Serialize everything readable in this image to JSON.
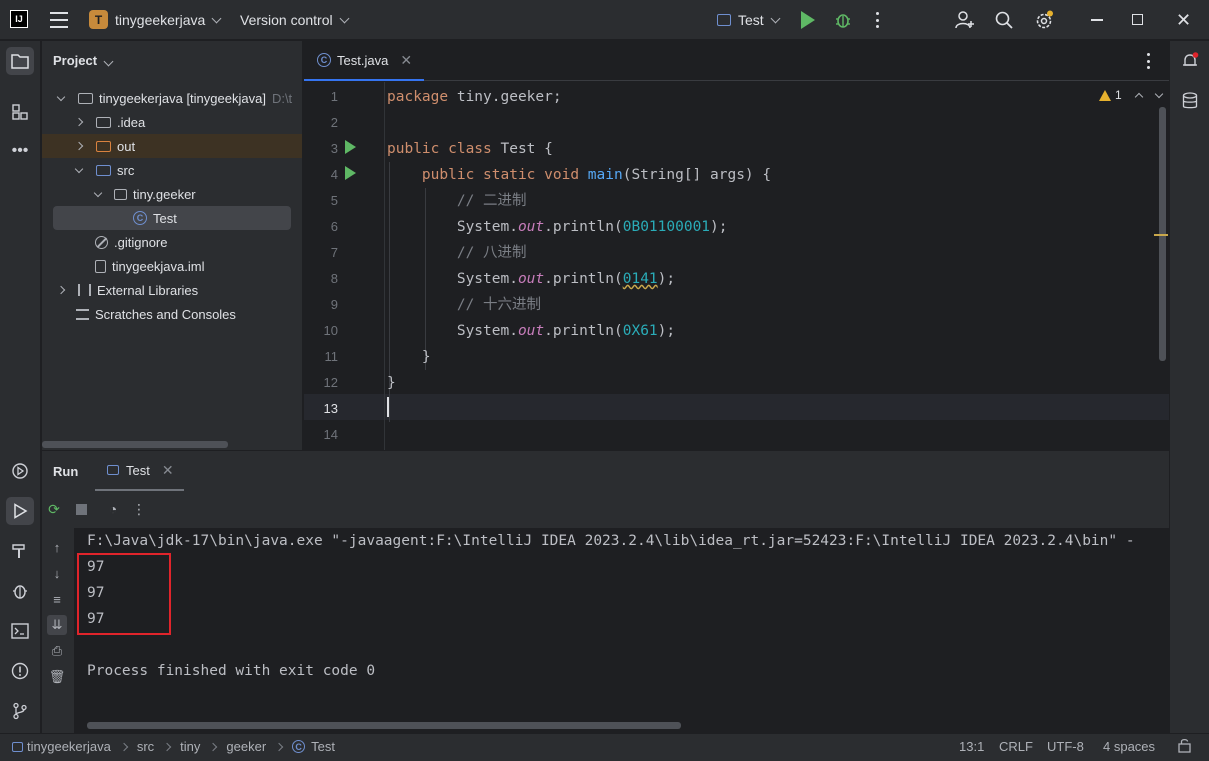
{
  "titlebar": {
    "logo": "IJ",
    "project_badge": "T",
    "project_name": "tinygeekerjava",
    "vcs_label": "Version control",
    "run_config": "Test",
    "icons": [
      "hamburger-icon",
      "run-icon",
      "debug-icon",
      "more-icon",
      "add-user-icon",
      "search-icon",
      "settings-icon",
      "minimize-icon",
      "maximize-icon",
      "close-icon"
    ],
    "settings_badge_color": "#e6b12e"
  },
  "project_panel": {
    "title": "Project",
    "root": {
      "name": "tinygeekerjava [tinygeekjava]",
      "path": "D:\\t"
    },
    "items": [
      {
        "label": ".idea",
        "type": "folder"
      },
      {
        "label": "out",
        "type": "folder-excluded"
      },
      {
        "label": "src",
        "type": "folder-source"
      },
      {
        "label": "tiny.geeker",
        "type": "package"
      },
      {
        "label": "Test",
        "type": "class"
      },
      {
        "label": ".gitignore",
        "type": "ignore-file"
      },
      {
        "label": "tinygeekjava.iml",
        "type": "file"
      },
      {
        "label": "External Libraries",
        "type": "libraries"
      },
      {
        "label": "Scratches and Consoles",
        "type": "scratches"
      }
    ]
  },
  "editor": {
    "tab": "Test.java",
    "warnings": "1",
    "current_line": "13",
    "lines": [
      {
        "n": "1",
        "t": "package tiny.geeker;"
      },
      {
        "n": "2",
        "t": ""
      },
      {
        "n": "3",
        "t": "public class Test {"
      },
      {
        "n": "4",
        "t": "    public static void main(String[] args) {"
      },
      {
        "n": "5",
        "t": "        // 二进制"
      },
      {
        "n": "6",
        "t": "        System.out.println(0B01100001);"
      },
      {
        "n": "7",
        "t": "        // 八进制"
      },
      {
        "n": "8",
        "t": "        System.out.println(0141);"
      },
      {
        "n": "9",
        "t": "        // 十六进制"
      },
      {
        "n": "10",
        "t": "        System.out.println(0X61);"
      },
      {
        "n": "11",
        "t": "    }"
      },
      {
        "n": "12",
        "t": "}"
      },
      {
        "n": "13",
        "t": ""
      },
      {
        "n": "14",
        "t": ""
      }
    ],
    "code": {
      "l1_kw": "package",
      "l1_rest": " tiny.geeker;",
      "l3_kw": "public class",
      "l3_rest": " Test {",
      "l4_indent": "    ",
      "l4_kw": "public static void",
      "l4_fn": "main",
      "l4_rest": "(String[] args) {",
      "indent": "        ",
      "c5": "// 二进制",
      "c7": "// 八进制",
      "c9": "// 十六进制",
      "sys": "System.",
      "out": "out",
      "println": ".println(",
      "close": ");",
      "v6": "0B01100001",
      "v8": "0141",
      "v10": "0X61",
      "l11": "    }",
      "l12": "}"
    }
  },
  "run_panel": {
    "title": "Run",
    "tab": "Test",
    "console": [
      "F:\\Java\\jdk-17\\bin\\java.exe \"-javaagent:F:\\IntelliJ IDEA 2023.2.4\\lib\\idea_rt.jar=52423:F:\\IntelliJ IDEA 2023.2.4\\bin\" -",
      "97",
      "97",
      "97",
      "",
      "Process finished with exit code 0"
    ],
    "highlight_color": "#e0242b"
  },
  "statusbar": {
    "breadcrumbs": [
      "tinygeekerjava",
      "src",
      "tiny",
      "geeker",
      "Test"
    ],
    "position": "13:1",
    "line_ending": "CRLF",
    "encoding": "UTF-8",
    "indent": "4 spaces"
  }
}
